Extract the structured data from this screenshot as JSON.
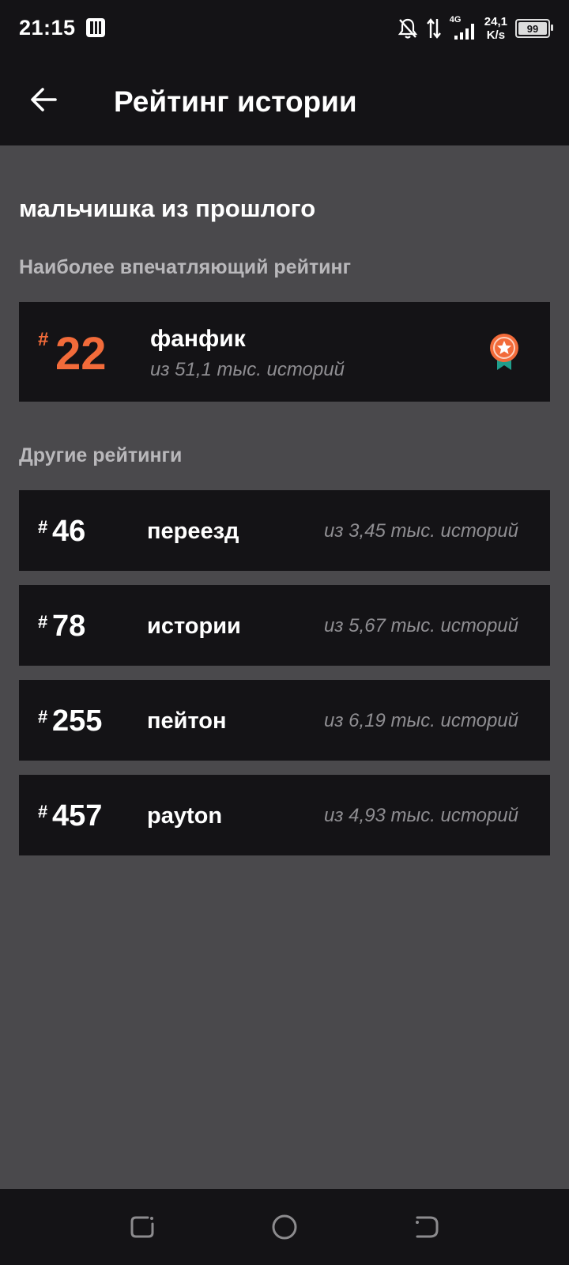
{
  "status_bar": {
    "time": "21:15",
    "network": "4G",
    "speed_value": "24,1",
    "speed_unit": "K/s",
    "battery": "99"
  },
  "app_bar": {
    "title": "Рейтинг истории"
  },
  "story_title": "мальчишка из прошлого",
  "top_section_label": "Наиболее впечатляющий рейтинг",
  "top_rank": {
    "hash": "#",
    "rank": "22",
    "tag": "фанфик",
    "subtitle": "из 51,1 тыс. историй"
  },
  "other_section_label": "Другие рейтинги",
  "other_ranks": [
    {
      "hash": "#",
      "rank": "46",
      "tag": "переезд",
      "subtitle": "из 3,45 тыс. историй"
    },
    {
      "hash": "#",
      "rank": "78",
      "tag": "истории",
      "subtitle": "из 5,67 тыс. историй"
    },
    {
      "hash": "#",
      "rank": "255",
      "tag": "пейтон",
      "subtitle": "из 6,19 тыс. историй"
    },
    {
      "hash": "#",
      "rank": "457",
      "tag": "payton",
      "subtitle": "из 4,93 тыс. историй"
    }
  ],
  "colors": {
    "accent": "#f26b3a",
    "medal_ribbon": "#1f9e8c",
    "background": "#4a494c",
    "card": "#141316",
    "muted_text": "#8f8e92"
  }
}
